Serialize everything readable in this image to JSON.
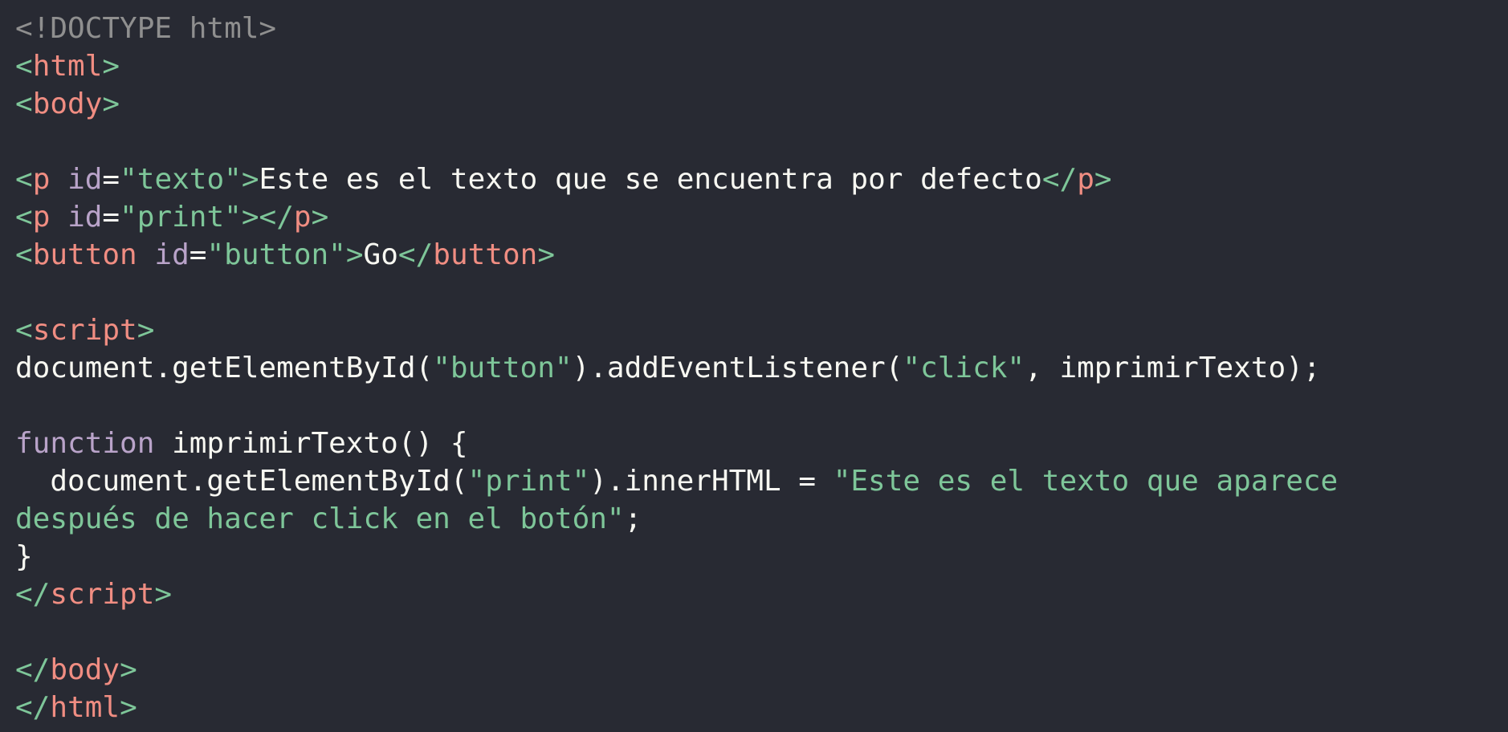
{
  "code": {
    "line1": {
      "doctype": "<!DOCTYPE html>"
    },
    "line2": {
      "open": "<",
      "tag": "html",
      "close": ">"
    },
    "line3": {
      "open": "<",
      "tag": "body",
      "close": ">"
    },
    "line5": {
      "open": "<",
      "tag": "p",
      "space": " ",
      "attr": "id",
      "eq": "=",
      "val": "\"texto\"",
      "close": ">",
      "text": "Este es el texto que se encuentra por defecto",
      "end_open": "</",
      "end_tag": "p",
      "end_close": ">"
    },
    "line6": {
      "open": "<",
      "tag": "p",
      "space": " ",
      "attr": "id",
      "eq": "=",
      "val": "\"print\"",
      "close": ">",
      "end_open": "</",
      "end_tag": "p",
      "end_close": ">"
    },
    "line7": {
      "open": "<",
      "tag": "button",
      "space": " ",
      "attr": "id",
      "eq": "=",
      "val": "\"button\"",
      "close": ">",
      "text": "Go",
      "end_open": "</",
      "end_tag": "button",
      "end_close": ">"
    },
    "line9": {
      "open": "<",
      "tag": "script",
      "close": ">"
    },
    "line10": {
      "a": "document.getElementById(",
      "s1": "\"button\"",
      "b": ").addEventListener(",
      "s2": "\"click\"",
      "c": ", imprimirTexto);"
    },
    "line12": {
      "kw": "function",
      "rest": " imprimirTexto() {"
    },
    "line13": {
      "indent": "  ",
      "a": "document.getElementById(",
      "s1": "\"print\"",
      "b": ").innerHTML = ",
      "s2": "\"Este es el texto que aparece"
    },
    "line14": {
      "s": "después de hacer click en el botón\"",
      "end": ";"
    },
    "line15": {
      "brace": "}"
    },
    "line16": {
      "open": "</",
      "tag": "script",
      "close": ">"
    },
    "line18": {
      "open": "</",
      "tag": "body",
      "close": ">"
    },
    "line19": {
      "open": "</",
      "tag": "html",
      "close": ">"
    }
  },
  "colors": {
    "background": "#282a33",
    "tag_name": "#f08d82",
    "bracket": "#7ec699",
    "attribute": "#b9a3c9",
    "string": "#7ec699",
    "text": "#f8f8f2",
    "doctype": "#8f8f8f",
    "keyword": "#b9a3c9"
  }
}
